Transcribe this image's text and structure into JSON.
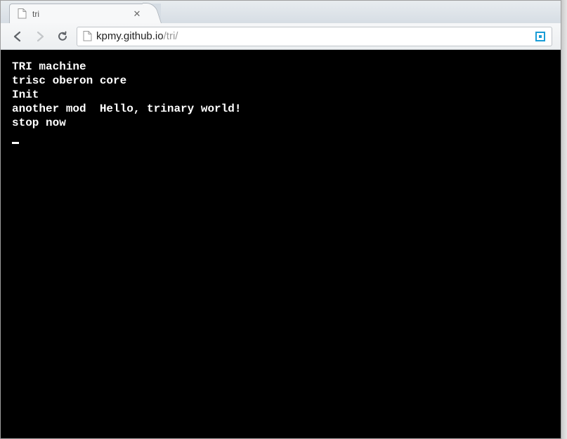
{
  "tab": {
    "title": "tri"
  },
  "address": {
    "host": "kpmy.github.io",
    "path": "/tri/"
  },
  "terminal": {
    "lines": [
      "TRI machine",
      "trisc oberon core",
      "Init",
      "another mod  Hello, trinary world!",
      "stop now"
    ]
  }
}
